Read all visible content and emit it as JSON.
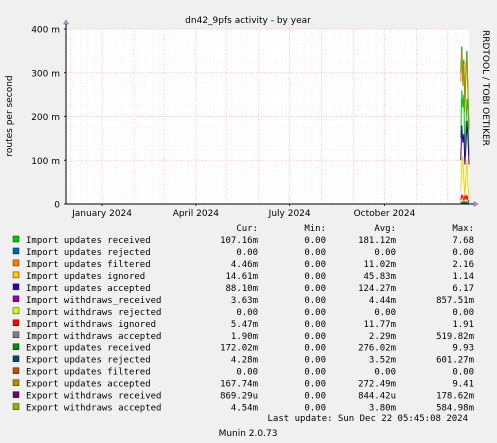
{
  "title": "dn42_9pfs activity - by year",
  "side_label": "RRDTOOL / TOBI OETIKER",
  "footer": "Munin 2.0.73",
  "last_update": "Last update: Sun Dec 22 05:45:08 2024",
  "colors": {
    "background": "#f0f0f0",
    "plot_background": "#ffffff",
    "grid_major": "#ffb0b0",
    "grid_minor": "#e8e8e8"
  },
  "chart_data": {
    "type": "line",
    "ylabel": "routes per second",
    "y_ticks": [
      "0",
      "100 m",
      "200 m",
      "300 m",
      "400 m"
    ],
    "y_tick_values": [
      0,
      0.1,
      0.2,
      0.3,
      0.4
    ],
    "ylim": [
      0,
      0.4
    ],
    "x_ticks": [
      "January 2024",
      "April 2024",
      "July 2024",
      "October 2024"
    ],
    "x_range": [
      "2023-11-27",
      "2024-12-22"
    ],
    "x_tick_dates": [
      "2024-01-01",
      "2024-04-01",
      "2024-07-01",
      "2024-10-01"
    ],
    "columns": [
      "Cur:",
      "Min:",
      "Avg:",
      "Max:"
    ],
    "series": [
      {
        "name": "Import updates received",
        "color": "#00cc00",
        "cur": "107.16m",
        "min": "0.00",
        "avg": "181.12m",
        "max": "7.68",
        "x": [
          "2024-12-14",
          "2024-12-15",
          "2024-12-16",
          "2024-12-17",
          "2024-12-18",
          "2024-12-19",
          "2024-12-20",
          "2024-12-21",
          "2024-12-22"
        ],
        "values": [
          0.15,
          0.26,
          0.22,
          0.25,
          0.1,
          0.18,
          0.24,
          0.21,
          0.11
        ]
      },
      {
        "name": "Import updates rejected",
        "color": "#0066b3",
        "cur": "0.00",
        "min": "0.00",
        "avg": "0.00",
        "max": "0.00",
        "x": [
          "2024-12-14",
          "2024-12-22"
        ],
        "values": [
          0,
          0
        ]
      },
      {
        "name": "Import updates filtered",
        "color": "#ff8000",
        "cur": "4.46m",
        "min": "0.00",
        "avg": "11.02m",
        "max": "2.16",
        "x": [
          "2024-12-14",
          "2024-12-15",
          "2024-12-16",
          "2024-12-17",
          "2024-12-18",
          "2024-12-19",
          "2024-12-20",
          "2024-12-21",
          "2024-12-22"
        ],
        "values": [
          0.01,
          0.015,
          0.02,
          0.008,
          0.012,
          0.02,
          0.01,
          0.009,
          0.005
        ]
      },
      {
        "name": "Import updates ignored",
        "color": "#ffcc00",
        "cur": "14.61m",
        "min": "0.00",
        "avg": "45.83m",
        "max": "1.14",
        "x": [
          "2024-12-14",
          "2024-12-15",
          "2024-12-16",
          "2024-12-17",
          "2024-12-18",
          "2024-12-19",
          "2024-12-20",
          "2024-12-21",
          "2024-12-22"
        ],
        "values": [
          0.03,
          0.09,
          0.11,
          0.05,
          0.02,
          0.07,
          0.1,
          0.04,
          0.015
        ]
      },
      {
        "name": "Import updates accepted",
        "color": "#330099",
        "cur": "88.10m",
        "min": "0.00",
        "avg": "124.27m",
        "max": "6.17",
        "x": [
          "2024-12-14",
          "2024-12-15",
          "2024-12-16",
          "2024-12-17",
          "2024-12-18",
          "2024-12-19",
          "2024-12-20",
          "2024-12-21",
          "2024-12-22"
        ],
        "values": [
          0.1,
          0.18,
          0.14,
          0.16,
          0.09,
          0.13,
          0.19,
          0.15,
          0.09
        ]
      },
      {
        "name": "Import withdraws_received",
        "color": "#990099",
        "cur": "3.63m",
        "min": "0.00",
        "avg": "4.44m",
        "max": "857.51m",
        "x": [
          "2024-12-14",
          "2024-12-17",
          "2024-12-20",
          "2024-12-22"
        ],
        "values": [
          0.004,
          0.006,
          0.005,
          0.004
        ]
      },
      {
        "name": "Import withdraws rejected",
        "color": "#ccff00",
        "cur": "0.00",
        "min": "0.00",
        "avg": "0.00",
        "max": "0.00",
        "x": [
          "2024-12-14",
          "2024-12-22"
        ],
        "values": [
          0,
          0
        ]
      },
      {
        "name": "Import withdraws ignored",
        "color": "#ff0000",
        "cur": "5.47m",
        "min": "0.00",
        "avg": "11.77m",
        "max": "1.91",
        "x": [
          "2024-12-14",
          "2024-12-15",
          "2024-12-16",
          "2024-12-17",
          "2024-12-18",
          "2024-12-19",
          "2024-12-20",
          "2024-12-21",
          "2024-12-22"
        ],
        "values": [
          0.008,
          0.02,
          0.015,
          0.01,
          0.018,
          0.012,
          0.02,
          0.009,
          0.005
        ]
      },
      {
        "name": "Import withdraws accepted",
        "color": "#808080",
        "cur": "1.90m",
        "min": "0.00",
        "avg": "2.29m",
        "max": "519.82m",
        "x": [
          "2024-12-14",
          "2024-12-17",
          "2024-12-20",
          "2024-12-22"
        ],
        "values": [
          0.002,
          0.003,
          0.002,
          0.002
        ]
      },
      {
        "name": "Export updates received",
        "color": "#008f00",
        "cur": "172.02m",
        "min": "0.00",
        "avg": "276.02m",
        "max": "9.93",
        "x": [
          "2024-12-14",
          "2024-12-15",
          "2024-12-16",
          "2024-12-17",
          "2024-12-18",
          "2024-12-19",
          "2024-12-20",
          "2024-12-21",
          "2024-12-22"
        ],
        "values": [
          0.3,
          0.36,
          0.28,
          0.33,
          0.22,
          0.31,
          0.35,
          0.26,
          0.17
        ]
      },
      {
        "name": "Export updates rejected",
        "color": "#00487d",
        "cur": "4.28m",
        "min": "0.00",
        "avg": "3.52m",
        "max": "601.27m",
        "x": [
          "2024-12-14",
          "2024-12-17",
          "2024-12-20",
          "2024-12-22"
        ],
        "values": [
          0.003,
          0.004,
          0.003,
          0.004
        ]
      },
      {
        "name": "Export updates filtered",
        "color": "#b35a00",
        "cur": "0.00",
        "min": "0.00",
        "avg": "0.00",
        "max": "0.00",
        "x": [
          "2024-12-14",
          "2024-12-22"
        ],
        "values": [
          0,
          0
        ]
      },
      {
        "name": "Export updates accepted",
        "color": "#b38f00",
        "cur": "167.74m",
        "min": "0.00",
        "avg": "272.49m",
        "max": "9.41",
        "x": [
          "2024-12-14",
          "2024-12-15",
          "2024-12-16",
          "2024-12-17",
          "2024-12-18",
          "2024-12-19",
          "2024-12-20",
          "2024-12-21",
          "2024-12-22"
        ],
        "values": [
          0.28,
          0.35,
          0.27,
          0.32,
          0.21,
          0.3,
          0.34,
          0.25,
          0.17
        ]
      },
      {
        "name": "Export withdraws received",
        "color": "#6b006b",
        "cur": "869.29u",
        "min": "0.00",
        "avg": "844.42u",
        "max": "178.62m",
        "x": [
          "2024-12-14",
          "2024-12-18",
          "2024-12-22"
        ],
        "values": [
          0.001,
          0.001,
          0.001
        ]
      },
      {
        "name": "Export withdraws accepted",
        "color": "#8fb300",
        "cur": "4.54m",
        "min": "0.00",
        "avg": "3.80m",
        "max": "584.98m",
        "x": [
          "2024-12-14",
          "2024-12-17",
          "2024-12-20",
          "2024-12-22"
        ],
        "values": [
          0.004,
          0.005,
          0.004,
          0.005
        ]
      }
    ]
  }
}
